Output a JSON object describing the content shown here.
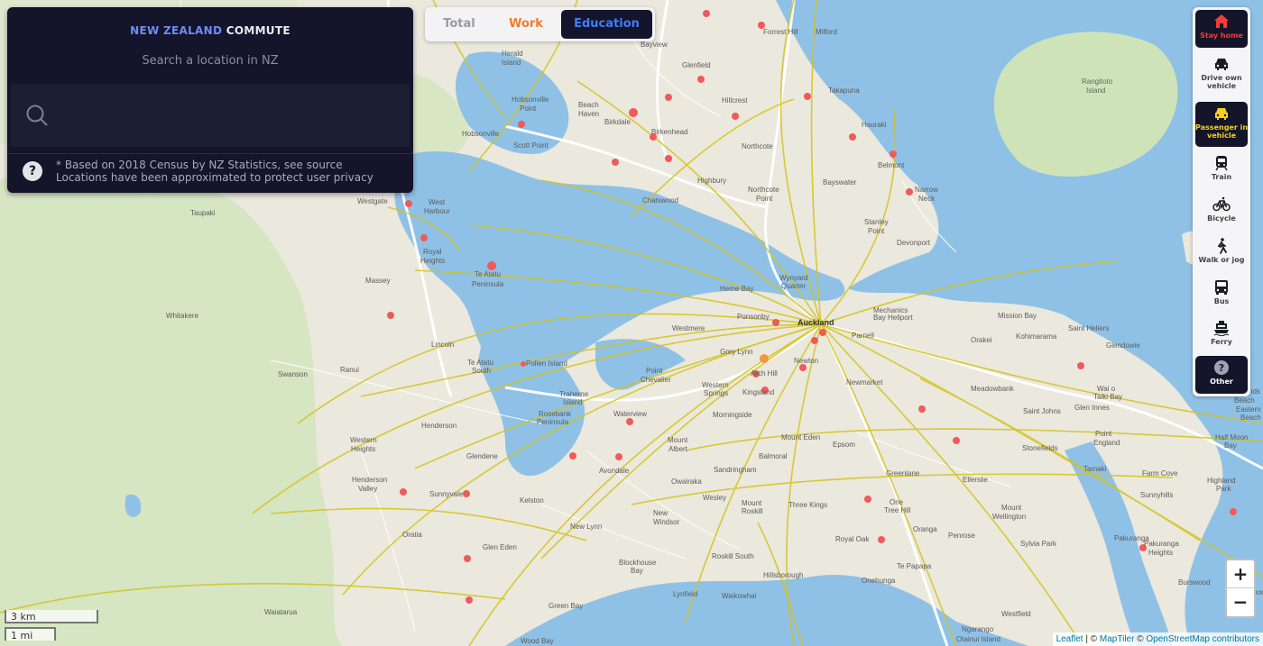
{
  "header": {
    "title_country": "NEW ZEALAND",
    "title_rest": "COMMUTE",
    "subtitle": "Search a location in NZ",
    "search_placeholder": "",
    "note_line1": "* Based on 2018 Census by NZ Statistics, see source",
    "note_line2": "Locations have been approximated to protect user privacy"
  },
  "tabs": [
    {
      "label": "Total",
      "color": "#9a9aa2"
    },
    {
      "label": "Work",
      "color": "#ee7d2b"
    },
    {
      "label": "Education",
      "color": "#3f7cff",
      "selected": true
    }
  ],
  "modes": [
    {
      "label": "Stay home",
      "icon": "house-icon",
      "selected": true,
      "color": "#f23b3b"
    },
    {
      "label": "Drive own vehicle",
      "icon": "car-icon"
    },
    {
      "label": "Passenger in vehicle",
      "icon": "car-icon",
      "selected": true,
      "color": "#f2d21b"
    },
    {
      "label": "Train",
      "icon": "train-icon"
    },
    {
      "label": "Bicycle",
      "icon": "bicycle-icon"
    },
    {
      "label": "Walk or jog",
      "icon": "walker-icon"
    },
    {
      "label": "Bus",
      "icon": "bus-icon"
    },
    {
      "label": "Ferry",
      "icon": "ferry-icon"
    },
    {
      "label": "Other",
      "icon": "question-icon",
      "selected": true
    }
  ],
  "zoom": {
    "in_label": "+",
    "out_label": "−"
  },
  "scale": {
    "km": "3 km",
    "mi": "1 mi"
  },
  "attribution": {
    "leaflet": "Leaflet",
    "sep1": " | © ",
    "maptiler": "MapTiler",
    "sep2": " © ",
    "osm": "OpenStreetMap contributors"
  },
  "colors": {
    "flow_line": "#d4c31a",
    "point": "#f05a5a",
    "water": "#8fc1e6",
    "land": "#e9e6dc",
    "park": "#cfe3b9"
  },
  "map_labels": {
    "place_names": [
      "Herald Island",
      "Hobsonville Point",
      "Hobsonville",
      "Scott Point",
      "Beach Haven",
      "Birkdale",
      "Birkenhead",
      "Bayview",
      "Glenfield",
      "Forrest Hill",
      "Milford",
      "Takapuna",
      "Hillcrest",
      "Northcote",
      "Hauraki",
      "Belmont",
      "Bayswater",
      "Narrow Neck",
      "Stanley Point",
      "Devonport",
      "Chatswood",
      "Highbury",
      "Northcote Point",
      "Westgate",
      "West Harbour",
      "Taupaki",
      "Royal Heights",
      "Te Atatu Peninsula",
      "Massey",
      "Whitakere",
      "Lincoln",
      "Swanson",
      "Ranui",
      "Te Atatu South",
      "Pollen Island",
      "Herne Bay",
      "Wynyard Quarter",
      "Ponsonby",
      "Westmere",
      "Auckland",
      "Parnell",
      "Mechanics Bay Heliport",
      "Grey Lynn",
      "Arch Hill",
      "Newton",
      "Newmarket",
      "Point Chevalier",
      "Western Springs",
      "Kingsland",
      "Traherne Island",
      "Rosebank Peninsula",
      "Waterview",
      "Morningside",
      "Mount Albert",
      "Henderson",
      "Western Heights",
      "Glendene",
      "Avondale",
      "Owairaka",
      "Sandringham",
      "Balmoral",
      "Mount Eden",
      "Epsom",
      "Greenlane",
      "Henderson Valley",
      "Sunnyvale",
      "Kelston",
      "Wesley",
      "Mount Roskill",
      "Three Kings",
      "One Tree Hill",
      "Ellerslie",
      "New Lynn",
      "New Windsor",
      "Oratia",
      "Glen Eden",
      "Royal Oak",
      "Onehunga",
      "Penrose",
      "Oranga",
      "Blockhouse Bay",
      "Roskill South",
      "Hillsborough",
      "Te Papapa",
      "Lynfield",
      "Waikowhai",
      "Waiatarua",
      "Green Bay",
      "Wood Bay",
      "Ngarango Otainui Island",
      "Westfield",
      "Mission Bay",
      "Kohimarama",
      "Saint Heliers",
      "Glendowie",
      "Orakei",
      "Meadowbank",
      "Saint Johns",
      "Glen Innes",
      "Point England",
      "Waiatarua",
      "Wai o Taiki Bay",
      "Stonefields",
      "Tamaki",
      "Half Moon Bay",
      "Highland Park",
      "Farm Cove",
      "Sunnyhills",
      "Mount Wellington",
      "Sylvia Park",
      "Pakuranga",
      "Pakuranga Heights",
      "Burswood",
      "Glenmore",
      "Rangitoto Island",
      "Bucklands Beach",
      "Eastern Beach"
    ]
  }
}
